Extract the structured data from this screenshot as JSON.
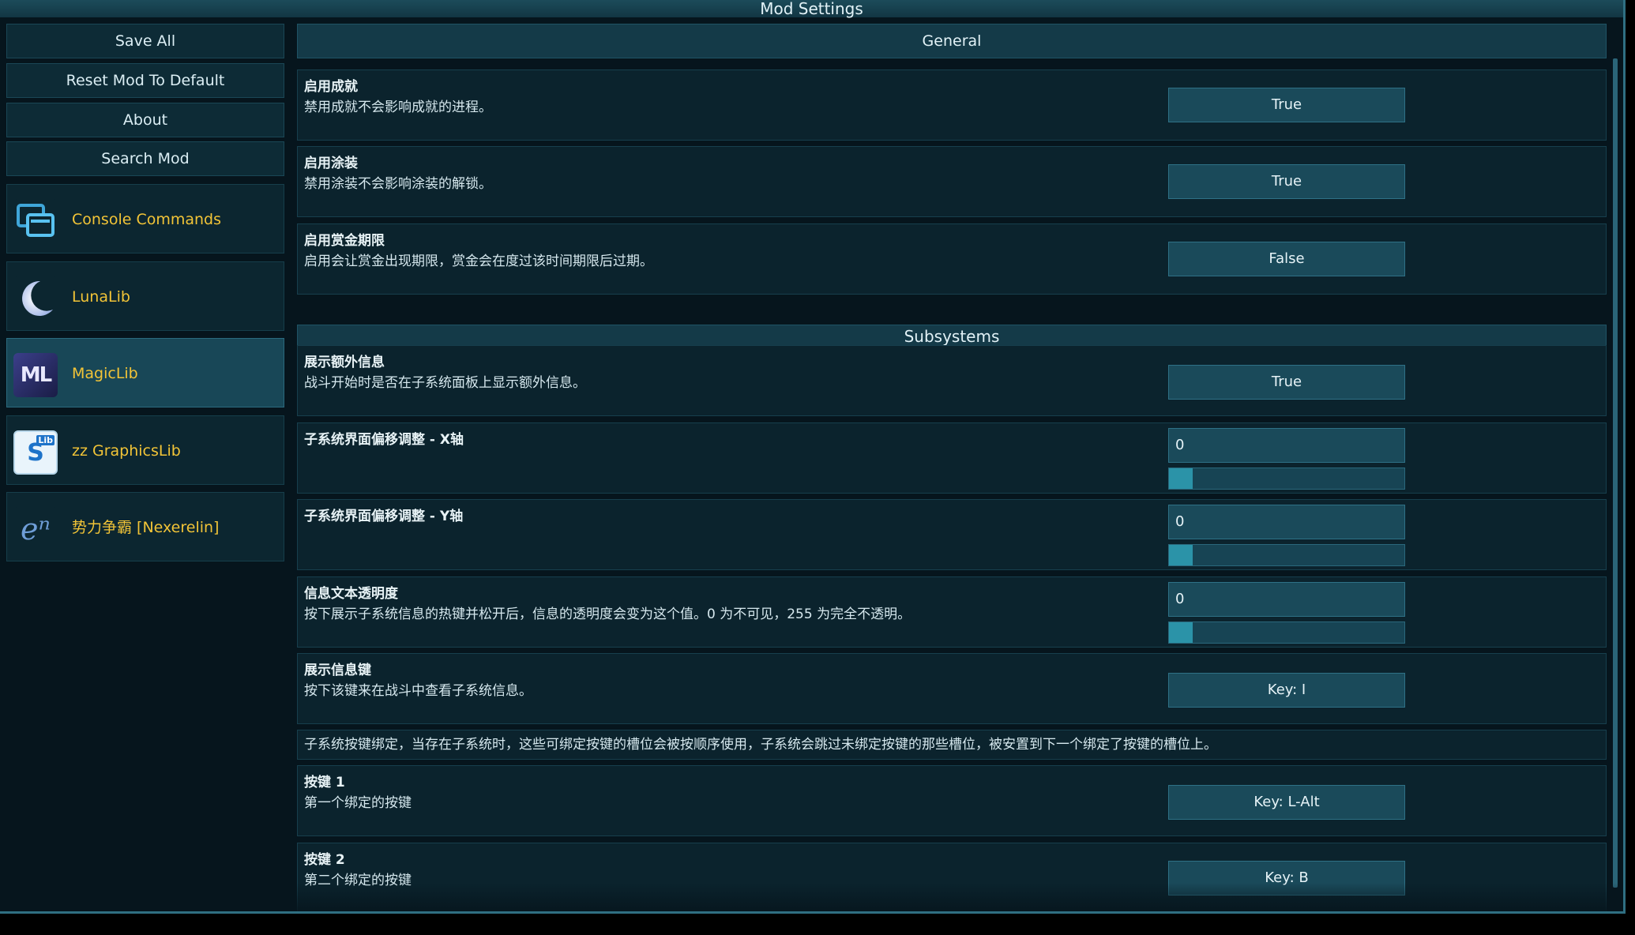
{
  "window": {
    "title": "Mod Settings"
  },
  "sidebar": {
    "buttons": [
      {
        "label": "Save All"
      },
      {
        "label": "Reset Mod To Default"
      },
      {
        "label": "About"
      },
      {
        "label": "Search Mod"
      }
    ],
    "mods": [
      {
        "label": "Console Commands",
        "icon": "console-commands-icon",
        "selected": false
      },
      {
        "label": "LunaLib",
        "icon": "crescent-moon-icon",
        "selected": false
      },
      {
        "label": "MagicLib",
        "icon": "magiclib-logo-icon",
        "icon_text": "ML",
        "selected": true
      },
      {
        "label": "zz GraphicsLib",
        "icon": "graphicslib-logo-icon",
        "icon_text": "S",
        "icon_badge": "Lib",
        "selected": false
      },
      {
        "label": "势力争霸 [Nexerelin]",
        "icon": "nexerelin-logo-icon",
        "icon_text": "eⁿ",
        "selected": false
      }
    ]
  },
  "sections": {
    "general": "General",
    "subsystems": "Subsystems"
  },
  "settings": {
    "enable_achievements": {
      "title": "启用成就",
      "desc": "禁用成就不会影响成就的进程。",
      "value": "True"
    },
    "enable_paintjobs": {
      "title": "启用涂装",
      "desc": "禁用涂装不会影响涂装的解锁。",
      "value": "True"
    },
    "enable_bounty_deadline": {
      "title": "启用赏金期限",
      "desc": "启用会让赏金出现期限，赏金会在度过该时间期限后过期。",
      "value": "False"
    },
    "show_extra_info": {
      "title": "展示额外信息",
      "desc": "战斗开始时是否在子系统面板上显示额外信息。",
      "value": "True"
    },
    "offset_x": {
      "title": "子系统界面偏移调整 - X轴",
      "value": "0",
      "slider_fraction": 0
    },
    "offset_y": {
      "title": "子系统界面偏移调整 - Y轴",
      "value": "0",
      "slider_fraction": 0
    },
    "text_opacity": {
      "title": "信息文本透明度",
      "desc": "按下展示子系统信息的热键并松开后，信息的透明度会变为这个值。0 为不可见，255 为完全不透明。",
      "value": "0",
      "slider_fraction": 0
    },
    "info_key": {
      "title": "展示信息键",
      "desc": "按下该键来在战斗中查看子系统信息。",
      "value": "Key: I"
    },
    "keybind_note": "子系统按键绑定，当存在子系统时，这些可绑定按键的槽位会被按顺序使用，子系统会跳过未绑定按键的那些槽位，被安置到下一个绑定了按键的槽位上。",
    "key1": {
      "title": "按键 1",
      "desc": "第一个绑定的按键",
      "value": "Key: L-Alt"
    },
    "key2": {
      "title": "按键 2",
      "desc": "第二个绑定的按键",
      "value": "Key: B"
    }
  },
  "colors": {
    "mod_label": "#f2c437",
    "accent": "#2b93a8",
    "panel": "#0b232d"
  }
}
